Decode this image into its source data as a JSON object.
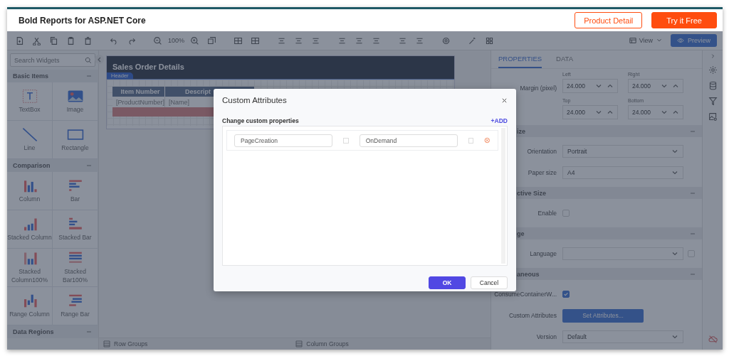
{
  "header": {
    "title": "Bold Reports for ASP.NET Core",
    "buttons": [
      {
        "label": "Product Detail",
        "kind": "outline"
      },
      {
        "label": "Try it Free",
        "kind": "primary"
      }
    ]
  },
  "toolbar": {
    "zoom": "100%",
    "view": "View",
    "preview": "Preview"
  },
  "widgets": {
    "search_placeholder": "Search Widgets",
    "groups": [
      {
        "title": "Basic Items",
        "items": [
          {
            "label": "TextBox",
            "kind": "textbox"
          },
          {
            "label": "Image",
            "kind": "image"
          },
          {
            "label": "Line",
            "kind": "line"
          },
          {
            "label": "Rectangle",
            "kind": "rectangle"
          }
        ]
      },
      {
        "title": "Comparison",
        "items": [
          {
            "label": "Column",
            "kind": "column"
          },
          {
            "label": "Bar",
            "kind": "bar"
          },
          {
            "label": "Stacked Column",
            "kind": "stacked-column"
          },
          {
            "label": "Stacked Bar",
            "kind": "stacked-bar"
          },
          {
            "label": "Stacked Column100%",
            "kind": "stacked-column100"
          },
          {
            "label": "Stacked Bar100%",
            "kind": "stacked-bar100"
          },
          {
            "label": "Range Column",
            "kind": "range-column"
          },
          {
            "label": "Range Bar",
            "kind": "range-bar"
          }
        ]
      },
      {
        "title": "Data Regions"
      }
    ]
  },
  "report": {
    "title": "Sales Order Details",
    "band": "Header",
    "columns": [
      "Item Number",
      "Descript"
    ],
    "cells": [
      "[ProductNumber]",
      "[Name]"
    ]
  },
  "groups_bar": [
    "Row Groups",
    "Column Groups"
  ],
  "properties": {
    "tabs": [
      {
        "label": "PROPERTIES",
        "selected": true
      },
      {
        "label": "DATA",
        "selected": false
      }
    ],
    "margin": {
      "label": "Margin (pixel)",
      "fields": [
        {
          "caption": "Left",
          "value": "24.000"
        },
        {
          "caption": "Right",
          "value": "24.000"
        },
        {
          "caption": "Top",
          "value": "24.000"
        },
        {
          "caption": "Bottom",
          "value": "24.000"
        }
      ]
    },
    "sections": [
      {
        "title": "ize",
        "rows": [
          {
            "kind": "select",
            "label": "Orientation",
            "value": "Portrait"
          },
          {
            "kind": "select",
            "label": "Paper size",
            "value": "A4"
          }
        ]
      },
      {
        "title": "ctive Size",
        "rows": [
          {
            "kind": "checkbox",
            "label": "Enable",
            "checked": false
          }
        ]
      },
      {
        "title": "ge",
        "rows": [
          {
            "kind": "select-check",
            "label": "Language",
            "checked": false
          }
        ]
      },
      {
        "title": "aneous",
        "rows": [
          {
            "kind": "checkbox",
            "label": "ConsumeContainerW...",
            "checked": true
          },
          {
            "kind": "button",
            "label": "Custom Attributes",
            "value": "Set Attributes..."
          },
          {
            "kind": "select",
            "label": "Version",
            "value": "Default"
          }
        ]
      }
    ]
  },
  "dialog": {
    "title": "Custom Attributes",
    "subtitle": "Change custom properties",
    "add": "+ADD",
    "rows": [
      {
        "name": "PageCreation",
        "name_checked": false,
        "value": "OnDemand",
        "value_checked": false
      }
    ],
    "buttons": [
      {
        "label": "OK",
        "kind": "primary"
      },
      {
        "label": "Cancel",
        "kind": "secondary"
      }
    ]
  }
}
